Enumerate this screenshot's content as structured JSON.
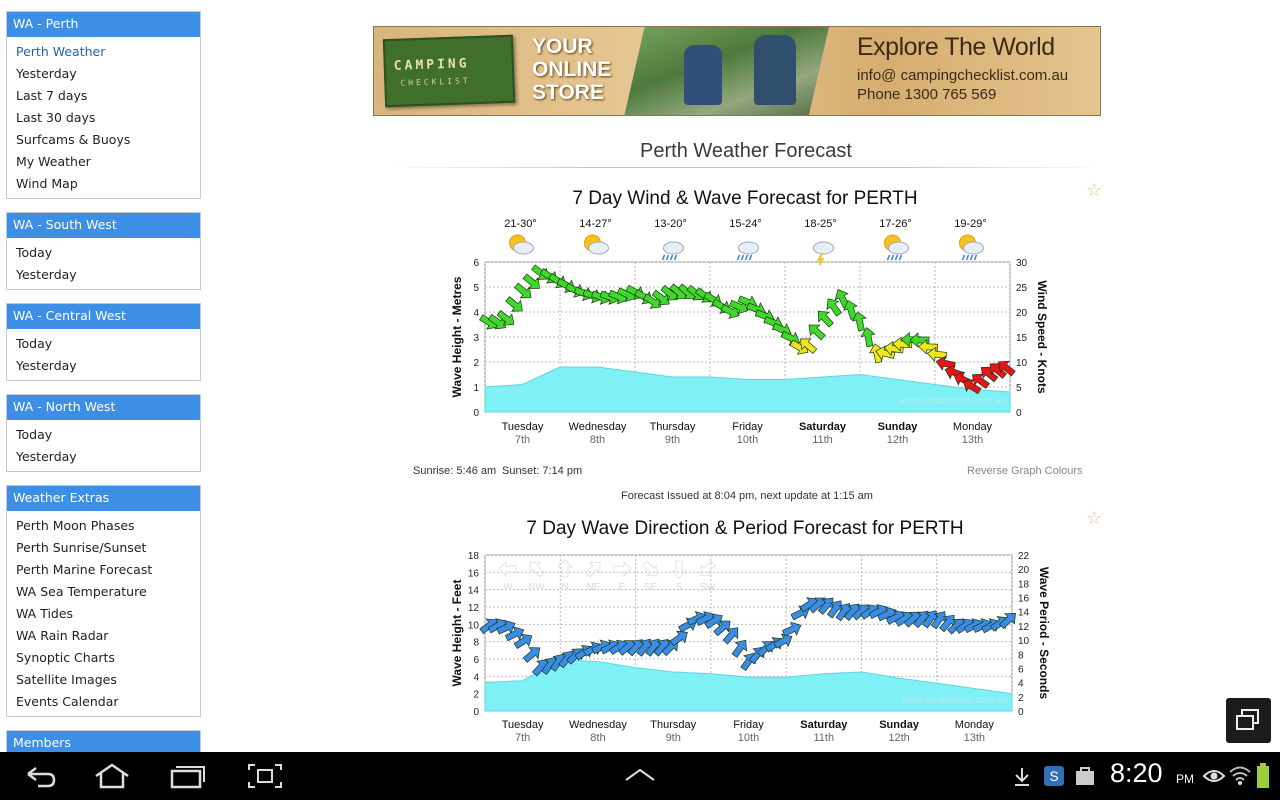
{
  "sidebar": [
    {
      "title": "WA - Perth",
      "items": [
        "Perth Weather",
        "Yesterday",
        "Last 7 days",
        "Last 30 days",
        "Surfcams & Buoys",
        "My Weather",
        "Wind Map"
      ]
    },
    {
      "title": "WA - South West",
      "items": [
        "Today",
        "Yesterday"
      ]
    },
    {
      "title": "WA - Central West",
      "items": [
        "Today",
        "Yesterday"
      ]
    },
    {
      "title": "WA - North West",
      "items": [
        "Today",
        "Yesterday"
      ]
    },
    {
      "title": "Weather Extras",
      "items": [
        "Perth Moon Phases",
        "Perth Sunrise/Sunset",
        "Perth Marine Forecast",
        "WA Sea Temperature",
        "WA Tides",
        "WA Rain Radar",
        "Synoptic Charts",
        "Satellite Images",
        "Events Calendar"
      ]
    },
    {
      "title": "Members",
      "items": []
    }
  ],
  "banner": {
    "logo_top": "CAMPING",
    "logo_bottom": "CHECKLIST",
    "slogan": [
      "YOUR",
      "ONLINE",
      "STORE"
    ],
    "headline": "Explore The World",
    "email": "info@ campingchecklist.com.au",
    "phone": "Phone 1300 765 569"
  },
  "page_title": "Perth Weather Forecast",
  "days": [
    {
      "day": "Tuesday",
      "date": "7th",
      "bold": false
    },
    {
      "day": "Wednesday",
      "date": "8th",
      "bold": false
    },
    {
      "day": "Thursday",
      "date": "9th",
      "bold": false
    },
    {
      "day": "Friday",
      "date": "10th",
      "bold": false
    },
    {
      "day": "Saturday",
      "date": "11th",
      "bold": true
    },
    {
      "day": "Sunday",
      "date": "12th",
      "bold": true
    },
    {
      "day": "Monday",
      "date": "13th",
      "bold": false
    }
  ],
  "wind_chart": {
    "title": "7 Day Wind & Wave Forecast for PERTH",
    "temps": [
      "21-30°",
      "14-27°",
      "13-20°",
      "15-24°",
      "18-25°",
      "17-26°",
      "19-29°"
    ],
    "weather_icons": [
      "sun-cloud-icon",
      "sun-cloud-icon",
      "rain-cloud-icon",
      "rain-cloud-icon",
      "storm-cloud-icon",
      "sun-shower-icon",
      "sun-shower-icon"
    ],
    "left_axis_label": "Wave Height - Metres",
    "right_axis_label": "Wind Speed - Knots",
    "left_ticks": [
      "0",
      "1",
      "2",
      "3",
      "4",
      "5",
      "6"
    ],
    "right_ticks": [
      "0",
      "5",
      "10",
      "15",
      "20",
      "25",
      "30"
    ],
    "watermark": "www.seabreeze.com.au",
    "sunrise": "Sunrise: 5:46 am",
    "sunset": "Sunset: 7:14 pm",
    "reverse_colours": "Reverse Graph Colours",
    "issued": "Forecast Issued at 8:04 pm, next update at 1:15 am"
  },
  "wave_chart": {
    "title": "7 Day Wave Direction & Period Forecast for PERTH",
    "left_axis_label": "Wave Height - Feet",
    "right_axis_label": "Wave Period - Seconds",
    "left_ticks": [
      "0",
      "2",
      "4",
      "6",
      "8",
      "10",
      "12",
      "14",
      "16",
      "18"
    ],
    "right_ticks": [
      "0",
      "2",
      "4",
      "6",
      "8",
      "10",
      "12",
      "14",
      "16",
      "18",
      "20",
      "22"
    ],
    "compass_legend": [
      "W",
      "NW",
      "N",
      "NE",
      "E",
      "SE",
      "S",
      "SW"
    ],
    "watermark": "www.seabreeze.com.au"
  },
  "chart_data": [
    {
      "type": "line",
      "title": "7 Day Wind & Wave Forecast for PERTH",
      "ylabel": "Wave Height - Metres",
      "y2label": "Wind Speed - Knots",
      "ylim": [
        0,
        6
      ],
      "y2lim": [
        0,
        30
      ],
      "categories": [
        "Tuesday 7th",
        "Wednesday 8th",
        "Thursday 9th",
        "Friday 10th",
        "Saturday 11th",
        "Sunday 12th",
        "Monday 13th"
      ],
      "series": [
        {
          "name": "Wave Height",
          "axis": "left",
          "x": [
            0,
            0.5,
            1,
            1.5,
            2,
            2.5,
            3,
            3.5,
            4,
            4.5,
            5,
            5.5,
            6,
            6.5,
            7
          ],
          "values": [
            1.0,
            1.1,
            1.8,
            1.8,
            1.6,
            1.4,
            1.4,
            1.3,
            1.3,
            1.4,
            1.5,
            1.3,
            1.1,
            0.9,
            0.8
          ]
        },
        {
          "name": "Wind Speed",
          "axis": "right",
          "x": [
            0,
            0.25,
            0.5,
            0.75,
            1,
            1.25,
            1.5,
            1.75,
            2,
            2.25,
            2.5,
            2.75,
            3,
            3.25,
            3.5,
            3.75,
            4,
            4.25,
            4.5,
            4.75,
            5,
            5.25,
            5.5,
            5.75,
            6,
            6.25,
            6.5,
            6.75,
            7
          ],
          "values": [
            18,
            18,
            24,
            28,
            26,
            24,
            23,
            23,
            24,
            22,
            24,
            24,
            23,
            20,
            22,
            19,
            16,
            12,
            18,
            23,
            18,
            11,
            13,
            15,
            12,
            8,
            5,
            8,
            9
          ]
        }
      ]
    },
    {
      "type": "line",
      "title": "7 Day Wave Direction & Period Forecast for PERTH",
      "ylabel": "Wave Height - Feet",
      "y2label": "Wave Period - Seconds",
      "ylim": [
        0,
        18
      ],
      "y2lim": [
        0,
        22
      ],
      "categories": [
        "Tuesday 7th",
        "Wednesday 8th",
        "Thursday 9th",
        "Friday 10th",
        "Saturday 11th",
        "Sunday 12th",
        "Monday 13th"
      ],
      "series": [
        {
          "name": "Wave Height",
          "axis": "left",
          "x": [
            0,
            0.5,
            1,
            1.5,
            2,
            2.5,
            3,
            3.5,
            4,
            4.5,
            5,
            5.5,
            6,
            6.5,
            7
          ],
          "values": [
            3.3,
            3.5,
            5.9,
            5.7,
            5.0,
            4.5,
            4.3,
            3.9,
            3.9,
            4.3,
            4.5,
            3.8,
            3.2,
            2.6,
            2.0
          ]
        },
        {
          "name": "Wave Period",
          "axis": "right",
          "x": [
            0,
            0.25,
            0.5,
            0.75,
            1,
            1.25,
            1.5,
            1.75,
            2,
            2.25,
            2.5,
            2.75,
            3,
            3.25,
            3.5,
            3.75,
            4,
            4.25,
            4.5,
            4.75,
            5,
            5.25,
            5.5,
            5.75,
            6,
            6.25,
            6.5,
            6.75,
            7
          ],
          "values": [
            12,
            12,
            10,
            6,
            7,
            8,
            9,
            9,
            9,
            9,
            9,
            13,
            13,
            11,
            7,
            9,
            10,
            15,
            15,
            14,
            14,
            14,
            13,
            13,
            13,
            12,
            12,
            12,
            13
          ]
        }
      ]
    }
  ],
  "system_bar": {
    "time": "8:20",
    "ampm": "PM"
  }
}
